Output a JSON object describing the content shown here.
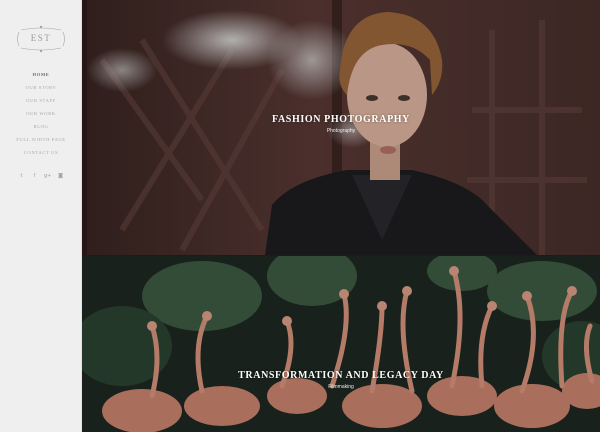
{
  "sidebar": {
    "logo_text": "EST",
    "nav": [
      {
        "label": "Home",
        "active": true
      },
      {
        "label": "Our Story",
        "active": false
      },
      {
        "label": "Our Staff",
        "active": false
      },
      {
        "label": "Our Work",
        "active": false
      },
      {
        "label": "Blog",
        "active": false
      },
      {
        "label": "Full Width Page",
        "active": false
      },
      {
        "label": "Contact Us",
        "active": false
      }
    ],
    "social": [
      {
        "icon": "twitter-icon",
        "glyph": "t"
      },
      {
        "icon": "facebook-icon",
        "glyph": "f"
      },
      {
        "icon": "google-plus-icon",
        "glyph": "g+"
      },
      {
        "icon": "instagram-icon",
        "glyph": "◙"
      }
    ]
  },
  "tiles": [
    {
      "title": "Fashion Photography",
      "category": "Photography"
    },
    {
      "title": "Transformation and Legacy Day",
      "category": "Filmmaking"
    }
  ],
  "colors": {
    "sidebar_bg": "#efefef",
    "nav_text": "#a9a9a9",
    "nav_active": "#6f6f6f",
    "caption_text": "#ffffff"
  }
}
